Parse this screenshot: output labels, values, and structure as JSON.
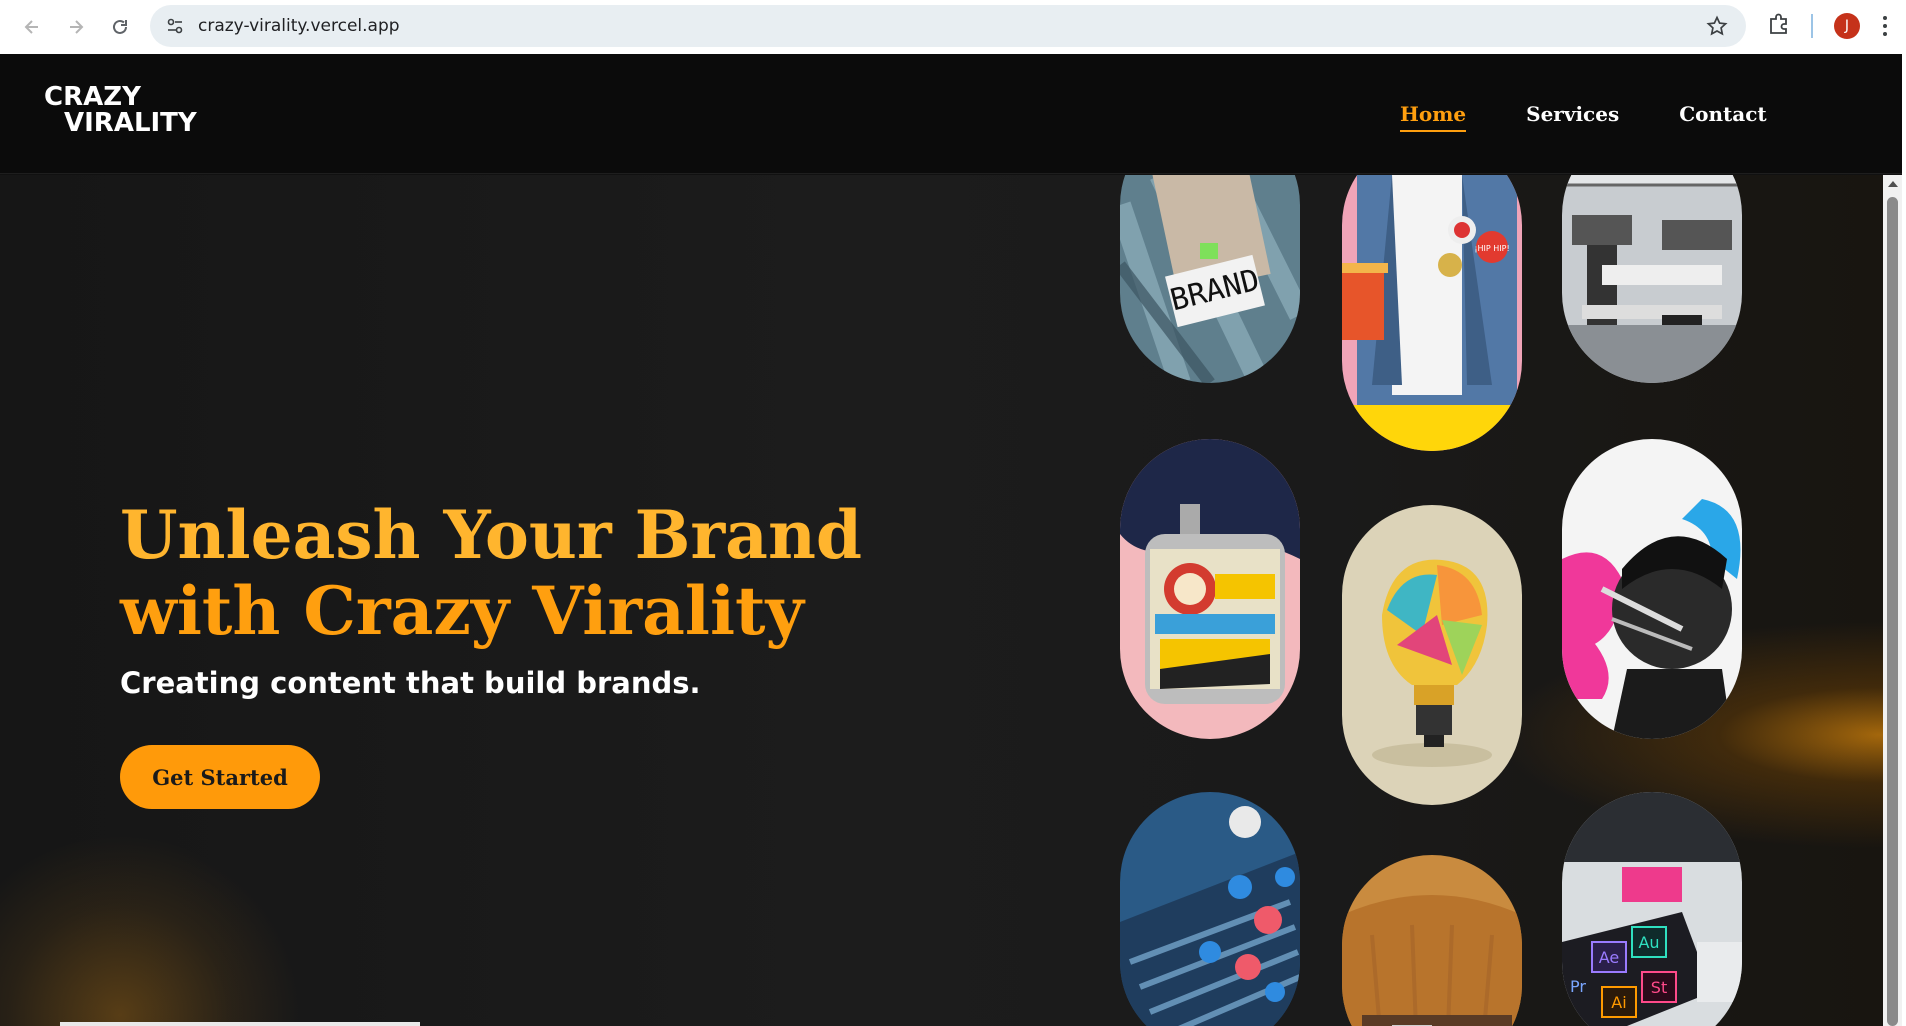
{
  "browser": {
    "url": "crazy-virality.vercel.app",
    "profile_initial": "J"
  },
  "header": {
    "logo_line1": "CRAZY",
    "logo_line2": "VIRALITY",
    "nav": [
      {
        "label": "Home",
        "active": true
      },
      {
        "label": "Services",
        "active": false
      },
      {
        "label": "Contact",
        "active": false
      }
    ]
  },
  "hero": {
    "headline_line1": "Unleash Your Brand",
    "headline_line2": "with Crazy Virality",
    "subheadline": "Creating content that build brands.",
    "cta_label": "Get Started"
  },
  "gallery": {
    "brand_cup_label": "BRAND",
    "pin_label": "¡HIP HIP!",
    "app_keys": [
      "Ae",
      "Au",
      "Ai",
      "St",
      "Pr"
    ]
  },
  "colors": {
    "accent": "#ff9f0f",
    "background": "#1a1a1a",
    "header_bg": "#0b0b0b"
  }
}
